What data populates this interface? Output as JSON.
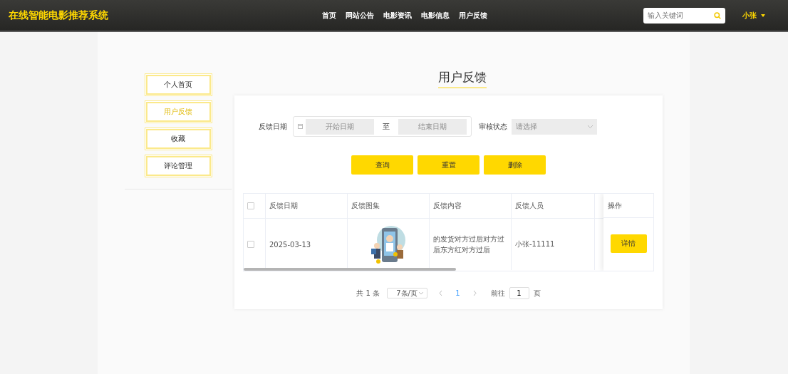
{
  "header": {
    "site_title": "在线智能电影推荐系统",
    "nav": [
      {
        "label": "首页"
      },
      {
        "label": "网站公告"
      },
      {
        "label": "电影资讯"
      },
      {
        "label": "电影信息"
      },
      {
        "label": "用户反馈"
      }
    ],
    "search": {
      "placeholder": "输入关键词"
    },
    "user": "小张"
  },
  "sidebar": {
    "items": [
      {
        "label": "个人首页",
        "selected": false
      },
      {
        "label": "用户反馈",
        "selected": true
      },
      {
        "label": "收藏",
        "selected": false
      },
      {
        "label": "评论管理",
        "selected": false
      }
    ]
  },
  "page_title": "用户反馈",
  "filters": {
    "date_label": "反馈日期",
    "start_placeholder": "开始日期",
    "separator": "至",
    "end_placeholder": "结束日期",
    "status_label": "审核状态",
    "status_placeholder": "请选择"
  },
  "actions": [
    "查询",
    "重置",
    "删除"
  ],
  "table": {
    "all_checked": false,
    "columns": [
      "反馈日期",
      "反馈图集",
      "反馈内容",
      "反馈人员"
    ],
    "action_column": "操作",
    "rows": [
      {
        "checked": false,
        "cells": [
          "2025-03-13",
          {
            "kind": "picture"
          },
          "的发货对方过后对方过后东方红对方过后",
          "小张-11111"
        ],
        "action": "详情"
      }
    ]
  },
  "pagination": {
    "total": "共 1 条",
    "page_size": "7条/页",
    "pages": [
      {
        "label": "1",
        "selected": true
      }
    ],
    "goto_label": "前往",
    "goto_value": "1",
    "goto_suffix": "页"
  }
}
